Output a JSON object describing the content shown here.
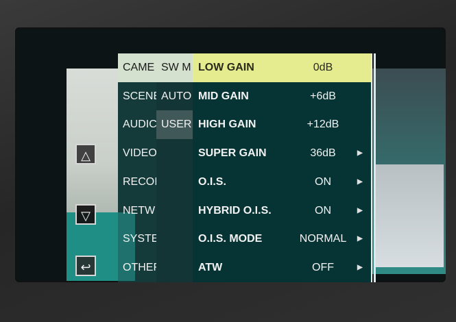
{
  "side_buttons": {
    "up": "△",
    "down": "▽",
    "back": "↩"
  },
  "main_menu": [
    {
      "label": "CAME",
      "selected": true
    },
    {
      "label": "SCENE",
      "selected": false
    },
    {
      "label": "AUDIC",
      "selected": false
    },
    {
      "label": "VIDEO",
      "selected": false
    },
    {
      "label": "RECOI",
      "selected": false
    },
    {
      "label": "NETW",
      "selected": false
    },
    {
      "label": "SYSTE",
      "selected": false
    },
    {
      "label": "OTHEF",
      "selected": false
    }
  ],
  "sub_menu": [
    {
      "label": "SW M",
      "selected": true
    },
    {
      "label": "AUTO",
      "selected": false
    },
    {
      "label": "USER",
      "selected": false
    }
  ],
  "items": [
    {
      "label": "LOW GAIN",
      "value": "0dB",
      "arrow": "",
      "active": true
    },
    {
      "label": "MID GAIN",
      "value": "+6dB",
      "arrow": "",
      "active": false
    },
    {
      "label": "HIGH GAIN",
      "value": "+12dB",
      "arrow": "",
      "active": false
    },
    {
      "label": "SUPER GAIN",
      "value": "36dB",
      "arrow": "▶",
      "active": false
    },
    {
      "label": "O.I.S.",
      "value": "ON",
      "arrow": "▶",
      "active": false
    },
    {
      "label": "HYBRID O.I.S.",
      "value": "ON",
      "arrow": "▶",
      "active": false
    },
    {
      "label": "O.I.S. MODE",
      "value": "NORMAL",
      "arrow": "▶",
      "active": false
    },
    {
      "label": "ATW",
      "value": "OFF",
      "arrow": "▶",
      "active": false
    }
  ]
}
